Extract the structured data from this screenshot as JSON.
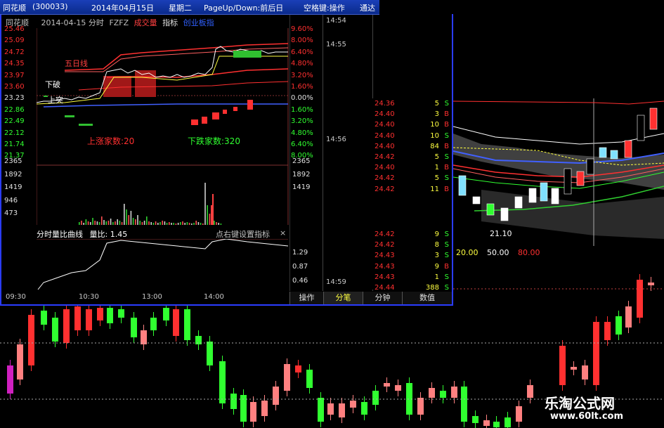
{
  "titlebar": {
    "app": "同花顺",
    "code": "(300033)",
    "date": "2014年04月15日",
    "weekday": "星期二",
    "hint": "PageUp/Down:前后日",
    "hint2": "空格键:操作",
    "hint3": "通达"
  },
  "chart_header": {
    "name": "同花顺",
    "info": "2014-04-15 分时",
    "formula": "FZFZ",
    "item1": "成交量",
    "item2": "指标",
    "item3": "创业板指"
  },
  "price_axis_left": [
    "25.46",
    "25.09",
    "24.72",
    "24.35",
    "23.97",
    "23.60",
    "23.23",
    "22.86",
    "22.49",
    "22.12",
    "21.74",
    "21.37"
  ],
  "pct_axis_right": [
    "9.60%",
    "8.00%",
    "6.40%",
    "4.80%",
    "3.20%",
    "1.60%",
    "0.00%",
    "1.60%",
    "3.20%",
    "4.80%",
    "6.40%",
    "8.00%"
  ],
  "volume_axis": [
    "2365",
    "1892",
    "1419",
    "946",
    "473"
  ],
  "ratio_axis": [
    "1.29",
    "0.87",
    "0.46"
  ],
  "annotations": {
    "up_count": "上涨家数:20",
    "down_count": "下跌家数:320",
    "label_five": "五日线",
    "label_down": "下破",
    "label_up": "上突"
  },
  "ratio_panel": {
    "title": "分时量比曲线",
    "ratio_label": "量比: 1.45",
    "hint": "点右键设置指标",
    "close": "×"
  },
  "time_axis": [
    "09:30",
    "10:30",
    "13:00",
    "14:00"
  ],
  "tick_list": {
    "times": [
      "14:54",
      "14:55",
      "14:56",
      "14:59"
    ]
  },
  "tabs": [
    "操作",
    "分笔",
    "分钟",
    "数值"
  ],
  "quotes": [
    {
      "price": "24.36",
      "vol": "5",
      "side": "S"
    },
    {
      "price": "24.40",
      "vol": "3",
      "side": "B"
    },
    {
      "price": "24.40",
      "vol": "10",
      "side": "B"
    },
    {
      "price": "24.40",
      "vol": "10",
      "side": "S"
    },
    {
      "price": "24.40",
      "vol": "84",
      "side": "B"
    },
    {
      "price": "24.42",
      "vol": "5",
      "side": "S"
    },
    {
      "price": "24.40",
      "vol": "1",
      "side": "B"
    },
    {
      "price": "24.42",
      "vol": "5",
      "side": "S"
    },
    {
      "price": "24.42",
      "vol": "11",
      "side": "B"
    }
  ],
  "quotes2": [
    {
      "price": "24.42",
      "vol": "9",
      "side": "S"
    },
    {
      "price": "24.42",
      "vol": "8",
      "side": "S"
    },
    {
      "price": "24.43",
      "vol": "3",
      "side": "S"
    },
    {
      "price": "24.43",
      "vol": "9",
      "side": "B"
    },
    {
      "price": "24.43",
      "vol": "1",
      "side": "S"
    },
    {
      "price": "24.44",
      "vol": "388",
      "side": "S"
    }
  ],
  "kline_inset": {
    "low_label": "21.10",
    "ma_labels": [
      "20.00",
      "50.00",
      "80.00"
    ]
  },
  "watermark": {
    "line1": "乐淘公式网",
    "line2": "www.60lt.com"
  },
  "colors": {
    "up": "#ff3030",
    "down": "#30ff30",
    "pink": "#ff8080",
    "axis_blue": "#2a3cff"
  }
}
